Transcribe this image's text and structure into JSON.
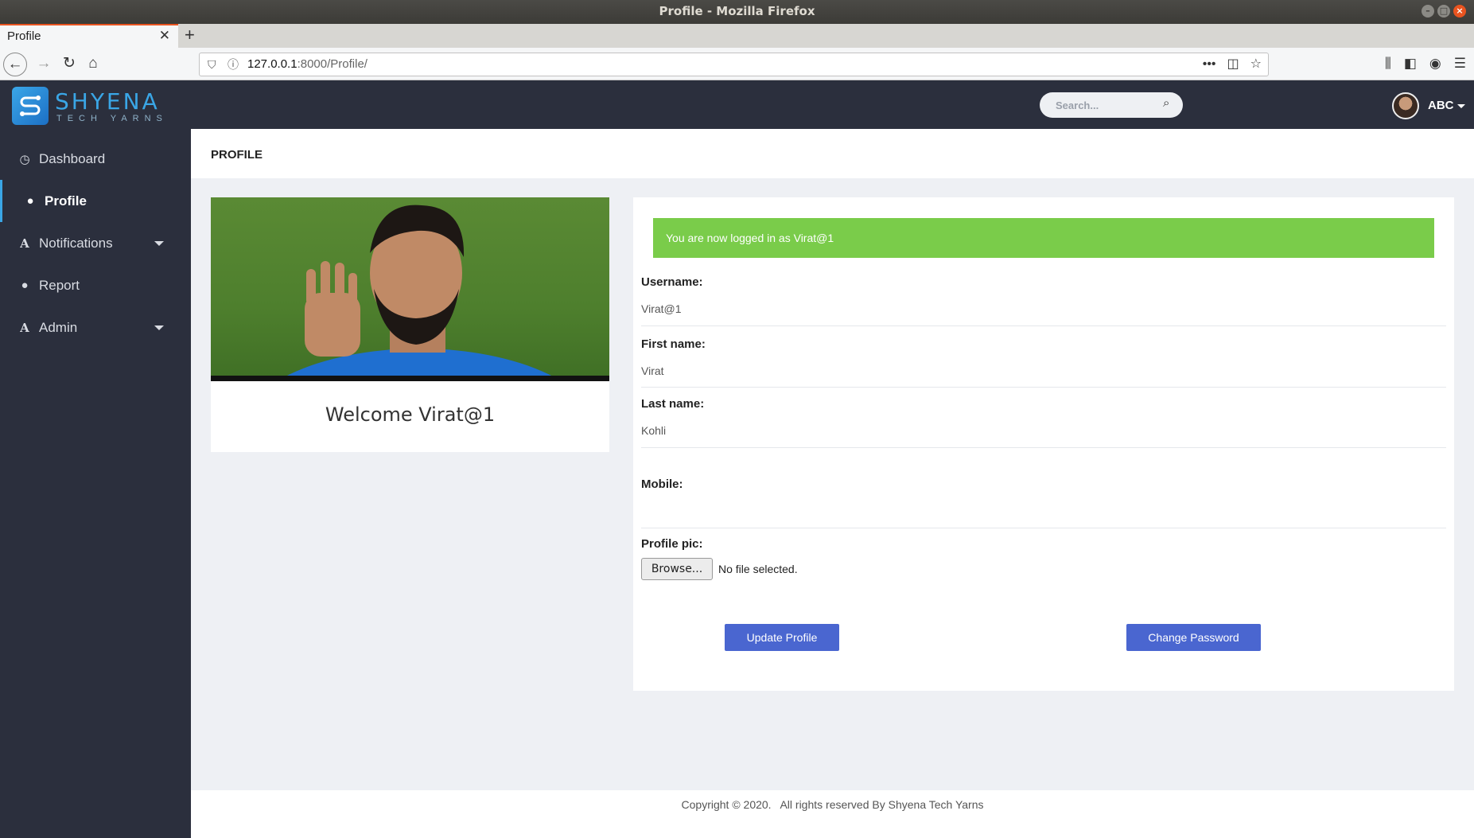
{
  "browser": {
    "window_title": "Profile - Mozilla Firefox",
    "tab_title": "Profile",
    "url_host": "127.0.0.1",
    "url_path": ":8000/Profile/"
  },
  "brand": {
    "name": "SHYENA",
    "tagline": "TECH YARNS"
  },
  "sidebar": {
    "items": [
      {
        "label": "Dashboard",
        "icon": "clock-icon"
      },
      {
        "label": "Profile",
        "icon": "user-icon"
      },
      {
        "label": "Notifications",
        "icon": "font-icon"
      },
      {
        "label": "Report",
        "icon": "user-icon"
      },
      {
        "label": "Admin",
        "icon": "font-icon"
      }
    ]
  },
  "topbar": {
    "search_placeholder": "Search...",
    "user_name": "ABC"
  },
  "page": {
    "title": "PROFILE"
  },
  "profile_card": {
    "welcome": "Welcome Virat@1"
  },
  "form": {
    "alert": "You are now logged in as Virat@1",
    "fields": [
      {
        "label": "Username:",
        "value": "Virat@1"
      },
      {
        "label": "First name:",
        "value": "Virat"
      },
      {
        "label": "Last name:",
        "value": "Kohli"
      },
      {
        "label": "Mobile:",
        "value": ""
      }
    ],
    "profile_pic_label": "Profile pic:",
    "browse_label": "Browse...",
    "no_file_text": "No file selected.",
    "update_button": "Update Profile",
    "change_password_button": "Change Password"
  },
  "footer": {
    "text": "Copyright © 2020.   All rights reserved By Shyena Tech Yarns"
  },
  "colors": {
    "sidebar_bg": "#2b2f3d",
    "accent": "#3aa6e6",
    "alert_bg": "#7acc4a",
    "button_bg": "#4a66d0"
  }
}
